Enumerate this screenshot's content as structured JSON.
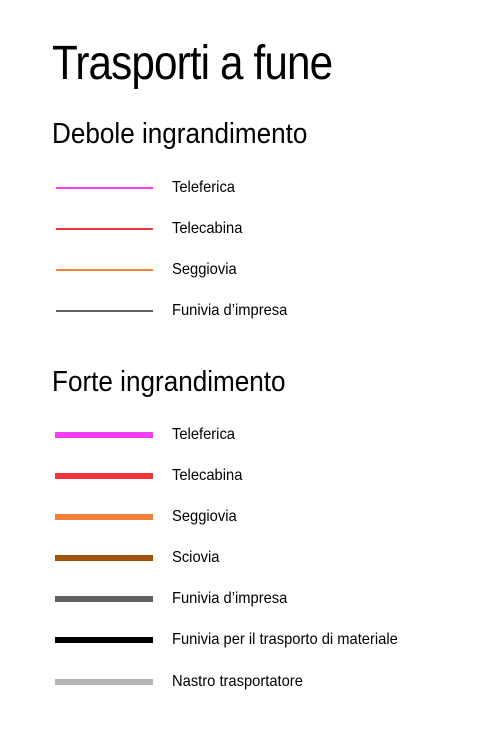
{
  "title": "Trasporti a fune",
  "low_zoom": {
    "heading": "Debole ingrandimento",
    "items": [
      {
        "label": "Teleferica",
        "color": "#f23ff2"
      },
      {
        "label": "Telecabina",
        "color": "#f0353c"
      },
      {
        "label": "Seggiovia",
        "color": "#f2803a"
      },
      {
        "label": "Funivia d’impresa",
        "color": "#606060"
      }
    ]
  },
  "high_zoom": {
    "heading": "Forte ingrandimento",
    "items": [
      {
        "label": "Teleferica",
        "color": "#f23ff2"
      },
      {
        "label": "Telecabina",
        "color": "#f0353c"
      },
      {
        "label": "Seggiovia",
        "color": "#f2803a"
      },
      {
        "label": "Sciovia",
        "color": "#a3520a"
      },
      {
        "label": "Funivia d’impresa",
        "color": "#606060"
      },
      {
        "label": "Funivia per il trasporto di materiale",
        "color": "#000000"
      },
      {
        "label": "Nastro trasportatore",
        "color": "#b4b4b4"
      }
    ]
  }
}
